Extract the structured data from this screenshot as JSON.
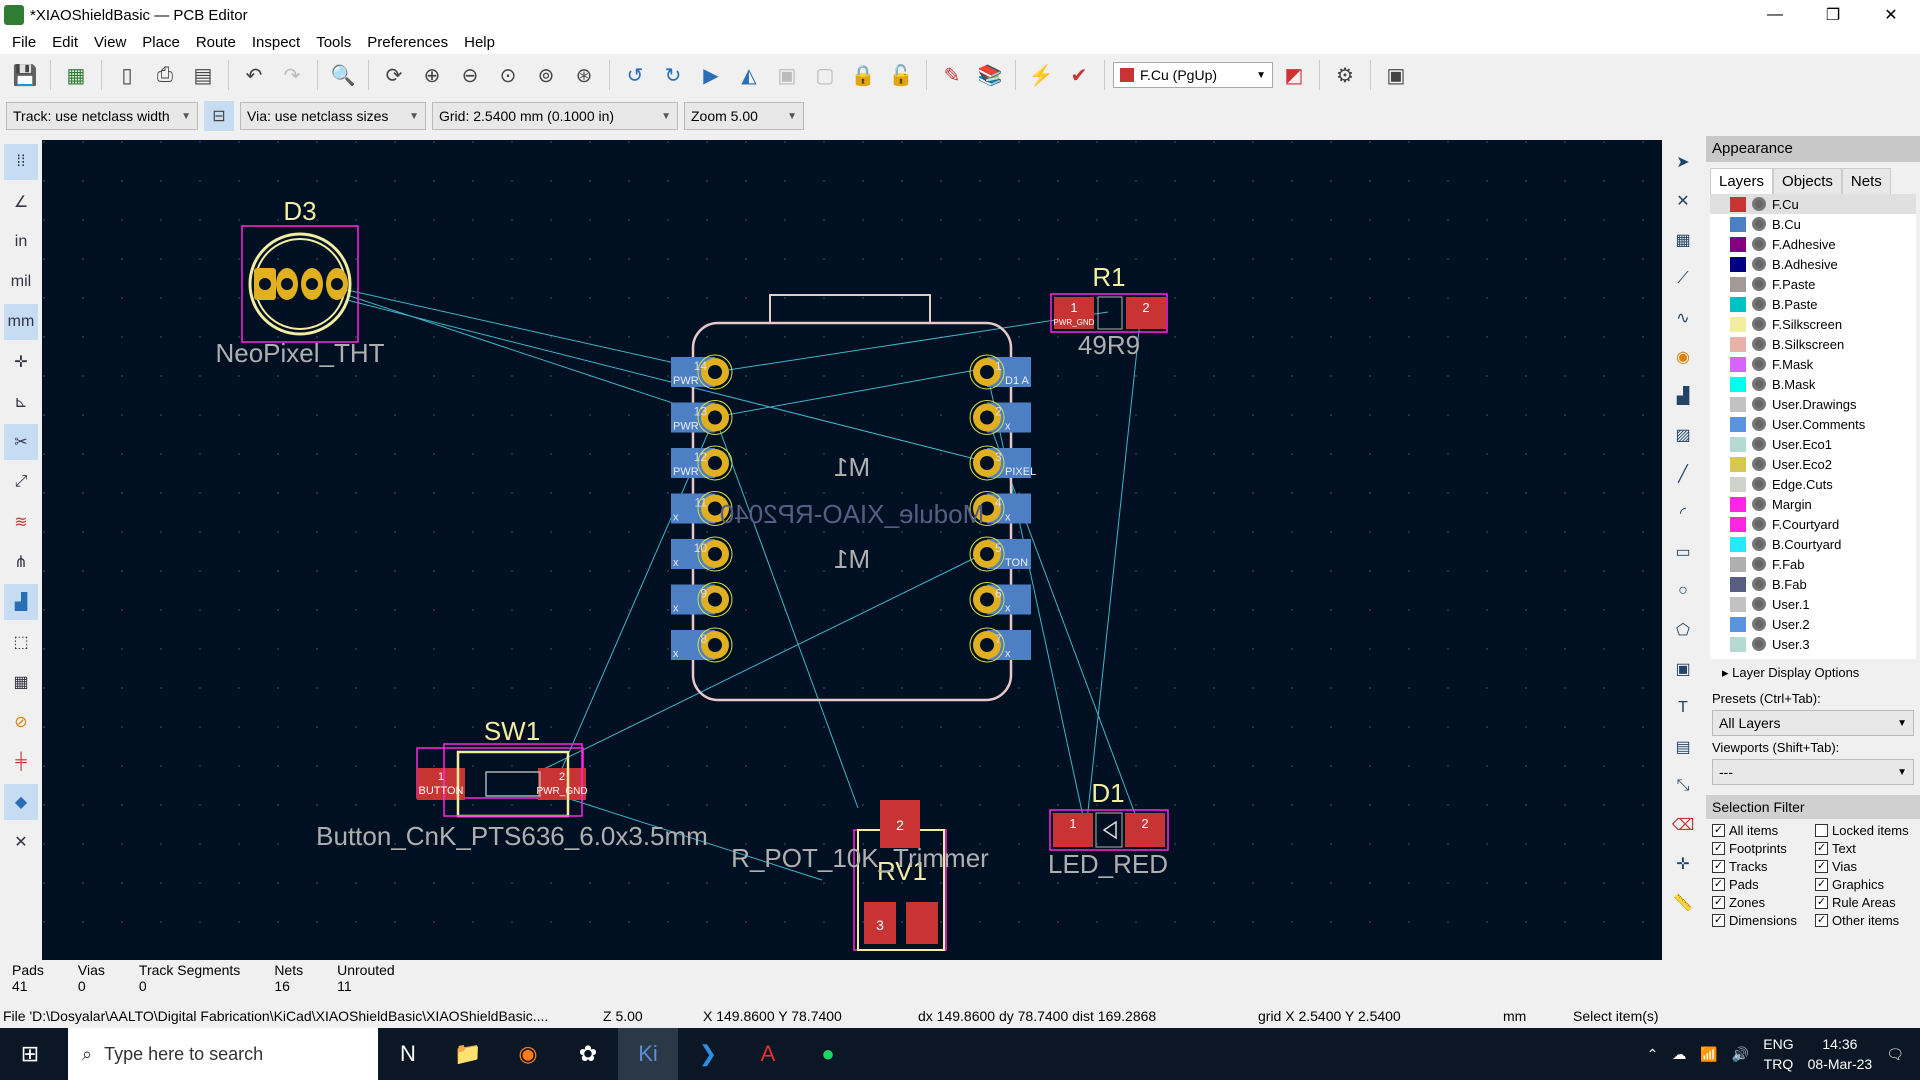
{
  "window": {
    "title": "*XIAOShieldBasic — PCB Editor",
    "minimize": "—",
    "maximize": "❐",
    "close": "✕"
  },
  "menu": [
    "File",
    "Edit",
    "View",
    "Place",
    "Route",
    "Inspect",
    "Tools",
    "Preferences",
    "Help"
  ],
  "toolbar": {
    "active_layer": "F.Cu (PgUp)",
    "active_layer_color": "#c83434"
  },
  "toolbar2": {
    "track": "Track: use netclass width",
    "via": "Via: use netclass sizes",
    "grid": "Grid: 2.5400 mm (0.1000 in)",
    "zoom": "Zoom 5.00"
  },
  "canvas": {
    "bg": "#001023",
    "footprints": [
      {
        "ref": "D3",
        "value": "NeoPixel_THT"
      },
      {
        "ref": "R1",
        "value": "49R9",
        "pads": [
          "1",
          "2"
        ],
        "pad_nets": [
          "PWR_GND",
          ""
        ]
      },
      {
        "ref": "M1",
        "value": "Module_XIAO-RP2040"
      },
      {
        "ref": "SW1",
        "value": "Button_CnK_PTS636_6.0x3.5mm",
        "pads": [
          "1",
          "2"
        ],
        "pad_nets": [
          "BUTTON",
          "PWR_GND"
        ]
      },
      {
        "ref": "RV1",
        "value": "R_POT_10K_Trimmer",
        "pads": [
          "2",
          "3"
        ]
      },
      {
        "ref": "D1",
        "value": "LED_RED",
        "pads": [
          "1",
          "2"
        ]
      }
    ],
    "m1_left_pins": [
      {
        "num": "14",
        "net": "PWR"
      },
      {
        "num": "13",
        "net": "PWR"
      },
      {
        "num": "12",
        "net": "PWR"
      },
      {
        "num": "11",
        "net": "x"
      },
      {
        "num": "10",
        "net": "x"
      },
      {
        "num": "9",
        "net": "x"
      },
      {
        "num": "8",
        "net": "x"
      }
    ],
    "m1_right_pins": [
      {
        "num": "1",
        "net": "D1 A"
      },
      {
        "num": "2",
        "net": "x"
      },
      {
        "num": "3",
        "net": "PIXEL"
      },
      {
        "num": "4",
        "net": "x"
      },
      {
        "num": "5",
        "net": "TON"
      },
      {
        "num": "6",
        "net": "x"
      },
      {
        "num": "7",
        "net": "x"
      }
    ]
  },
  "appearance": {
    "title": "Appearance",
    "tabs": [
      "Layers",
      "Objects",
      "Nets"
    ],
    "layers": [
      {
        "name": "F.Cu",
        "color": "#c83434"
      },
      {
        "name": "B.Cu",
        "color": "#4d7fc4"
      },
      {
        "name": "F.Adhesive",
        "color": "#84007c"
      },
      {
        "name": "B.Adhesive",
        "color": "#00007f"
      },
      {
        "name": "F.Paste",
        "color": "#a49a95"
      },
      {
        "name": "B.Paste",
        "color": "#00c2c2"
      },
      {
        "name": "F.Silkscreen",
        "color": "#f2eda1"
      },
      {
        "name": "B.Silkscreen",
        "color": "#e8b2a7"
      },
      {
        "name": "F.Mask",
        "color": "#d864ff"
      },
      {
        "name": "B.Mask",
        "color": "#02ffee"
      },
      {
        "name": "User.Drawings",
        "color": "#c2c2c2"
      },
      {
        "name": "User.Comments",
        "color": "#5994dc"
      },
      {
        "name": "User.Eco1",
        "color": "#b4dbd2"
      },
      {
        "name": "User.Eco2",
        "color": "#d8c852"
      },
      {
        "name": "Edge.Cuts",
        "color": "#d0d2cd"
      },
      {
        "name": "Margin",
        "color": "#ff26e2"
      },
      {
        "name": "F.Courtyard",
        "color": "#ff26e2"
      },
      {
        "name": "B.Courtyard",
        "color": "#26e9ff"
      },
      {
        "name": "F.Fab",
        "color": "#afafaf"
      },
      {
        "name": "B.Fab",
        "color": "#585d84"
      },
      {
        "name": "User.1",
        "color": "#c2c2c2"
      },
      {
        "name": "User.2",
        "color": "#5994dc"
      },
      {
        "name": "User.3",
        "color": "#b4dbd2"
      }
    ],
    "layer_display_options": "Layer Display Options",
    "presets_label": "Presets (Ctrl+Tab):",
    "presets_value": "All Layers",
    "viewports_label": "Viewports (Shift+Tab):",
    "viewports_value": "---"
  },
  "selection_filter": {
    "title": "Selection Filter",
    "items": [
      {
        "label": "All items",
        "checked": true
      },
      {
        "label": "Locked items",
        "checked": false
      },
      {
        "label": "Footprints",
        "checked": true
      },
      {
        "label": "Text",
        "checked": true
      },
      {
        "label": "Tracks",
        "checked": true
      },
      {
        "label": "Vias",
        "checked": true
      },
      {
        "label": "Pads",
        "checked": true
      },
      {
        "label": "Graphics",
        "checked": true
      },
      {
        "label": "Zones",
        "checked": true
      },
      {
        "label": "Rule Areas",
        "checked": true
      },
      {
        "label": "Dimensions",
        "checked": true
      },
      {
        "label": "Other items",
        "checked": true
      }
    ]
  },
  "stats": [
    {
      "label": "Pads",
      "value": "41"
    },
    {
      "label": "Vias",
      "value": "0"
    },
    {
      "label": "Track Segments",
      "value": "0"
    },
    {
      "label": "Nets",
      "value": "16"
    },
    {
      "label": "Unrouted",
      "value": "11"
    }
  ],
  "statusline": {
    "file": "File 'D:\\Dosyalar\\AALTO\\Digital Fabrication\\KiCad\\XIAOShieldBasic\\XIAOShieldBasic....",
    "zoom": "Z 5.00",
    "xy": "X 149.8600  Y 78.7400",
    "delta": "dx 149.8600  dy 78.7400  dist 169.2868",
    "grid": "grid X 2.5400  Y 2.5400",
    "units": "mm",
    "mode": "Select item(s)"
  },
  "taskbar": {
    "search_placeholder": "Type here to search",
    "lang1": "ENG",
    "lang2": "TRQ",
    "time": "14:36",
    "date": "08-Mar-23"
  }
}
